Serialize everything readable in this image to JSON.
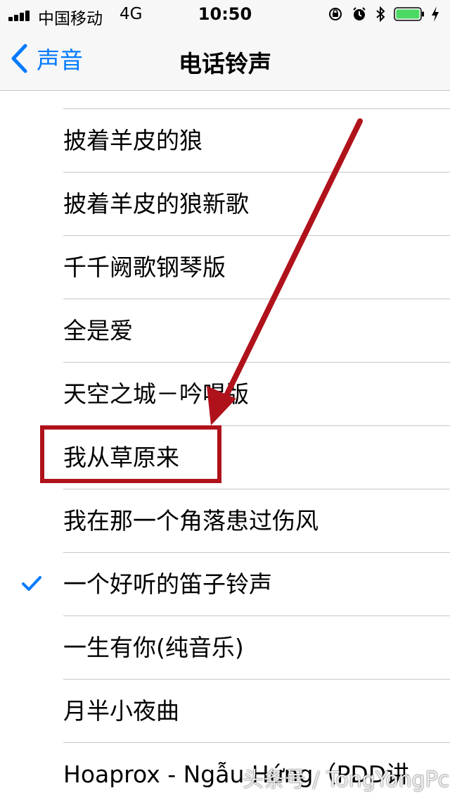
{
  "status_bar": {
    "carrier": "中国移动",
    "network": "4G",
    "time": "10:50",
    "icons": [
      "signal-icon",
      "orientation-lock-icon",
      "alarm-icon",
      "bluetooth-icon",
      "battery-icon",
      "charging-icon"
    ],
    "battery_color": "#4cd964"
  },
  "nav": {
    "back_label": "声音",
    "title": "电话铃声",
    "accent_color": "#007aff"
  },
  "ringtones": [
    {
      "label": "披着羊皮的狼",
      "selected": false
    },
    {
      "label": "披着羊皮的狼新歌",
      "selected": false
    },
    {
      "label": "千千阙歌钢琴版",
      "selected": false
    },
    {
      "label": "全是爱",
      "selected": false
    },
    {
      "label": "天空之城－吟唱版",
      "selected": false
    },
    {
      "label": "我从草原来",
      "selected": false
    },
    {
      "label": "我在那一个角落患过伤风",
      "selected": false
    },
    {
      "label": "一个好听的笛子铃声",
      "selected": true
    },
    {
      "label": "一生有你(纯音乐)",
      "selected": false
    },
    {
      "label": "月半小夜曲",
      "selected": false
    },
    {
      "label": "Hoaprox - Ngẫu Hứng（PDD讲",
      "selected": false
    }
  ],
  "annotation": {
    "highlight_color": "#b0121b",
    "highlighted_item": "我从草原来"
  },
  "watermark": "头条号 / TongYongPc"
}
